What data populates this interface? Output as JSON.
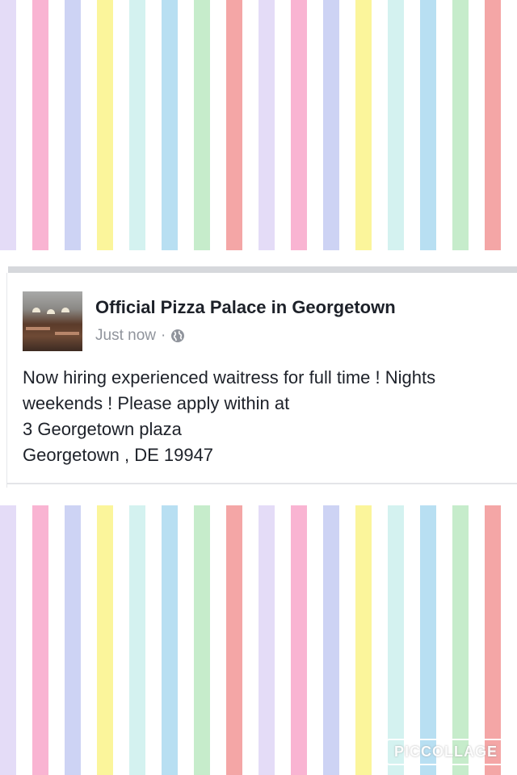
{
  "post": {
    "page_name": "Official Pizza Palace in Georgetown",
    "timestamp": "Just now",
    "separator": "·",
    "privacy_icon": "globe-icon",
    "lines": [
      "Now hiring experienced waitress for full time ! Nights",
      "weekends ! Please apply within at",
      "3 Georgetown plaza",
      "Georgetown , DE 19947"
    ]
  },
  "background": {
    "stripe_colors": [
      "#e4dcf7",
      "#f9b4d2",
      "#cdd3f4",
      "#fbf59b",
      "#d4f2f0",
      "#b8dff2",
      "#c6eccb",
      "#f4a6a6"
    ]
  },
  "watermark": {
    "text": "PICCOLLAGE"
  }
}
